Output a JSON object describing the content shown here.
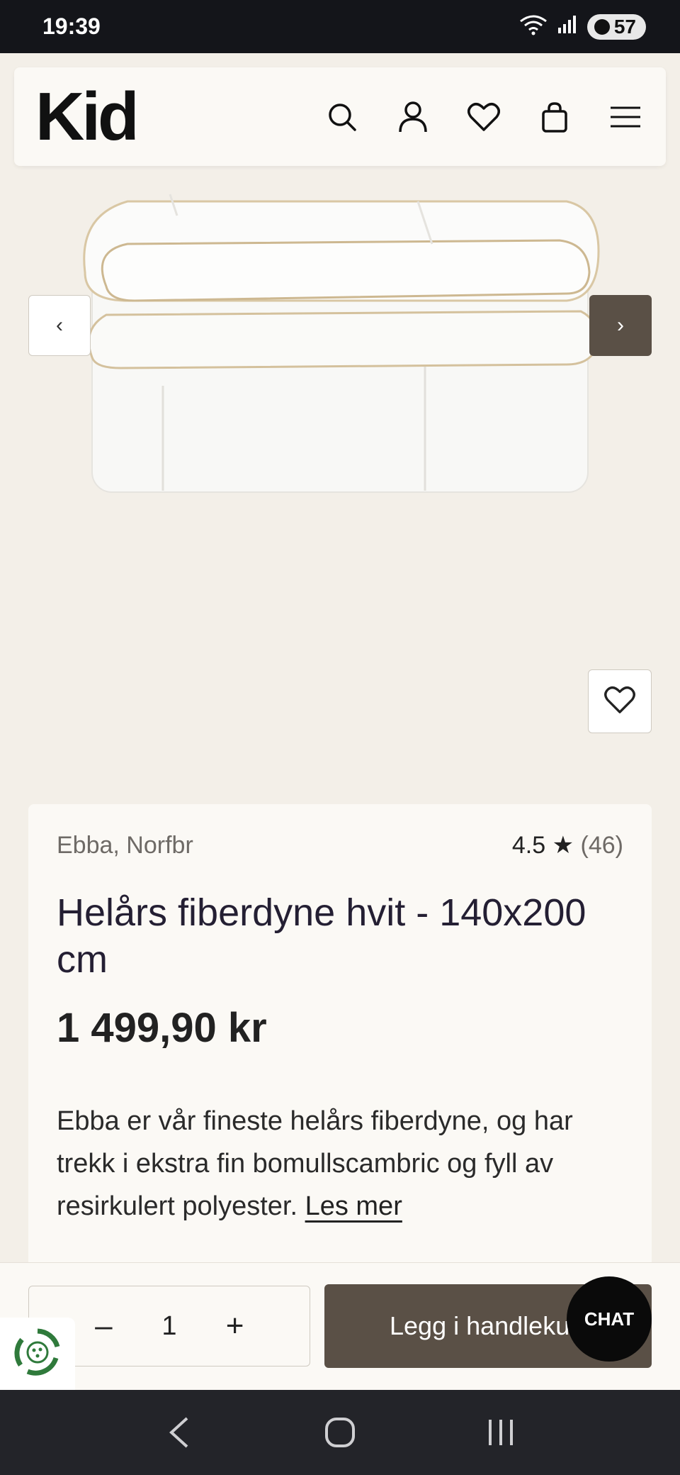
{
  "status_bar": {
    "time": "19:39",
    "battery": "57",
    "icons": [
      "wifi-6e-icon",
      "signal-icon",
      "battery-icon"
    ]
  },
  "header": {
    "logo": "Kid",
    "icons": [
      "search-icon",
      "account-icon",
      "wishlist-icon",
      "cart-icon",
      "menu-icon"
    ]
  },
  "gallery": {
    "prev_label": "‹",
    "next_label": "›",
    "image": "white-duvet-folded"
  },
  "product": {
    "brand": "Ebba, Norfbr",
    "rating_value": "4.5",
    "rating_star": "★",
    "rating_count": "(46)",
    "title": "Helårs fiberdyne hvit - 140x200 cm",
    "price": "1 499,90 kr",
    "description": "Ebba er vår fineste helårs fiberdyne, og har trekk i ekstra fin bomullscambric og fyll av resirkulert polyester.",
    "read_more": "Les mer"
  },
  "purchase": {
    "minus": "–",
    "quantity": "1",
    "plus": "+",
    "add_to_cart": "Legg i handlekurv"
  },
  "chat": {
    "label": "CHAT"
  },
  "colors": {
    "accent": "#5a5046",
    "background": "#f3efe8",
    "card": "#fbf9f5",
    "title": "#241f33"
  }
}
